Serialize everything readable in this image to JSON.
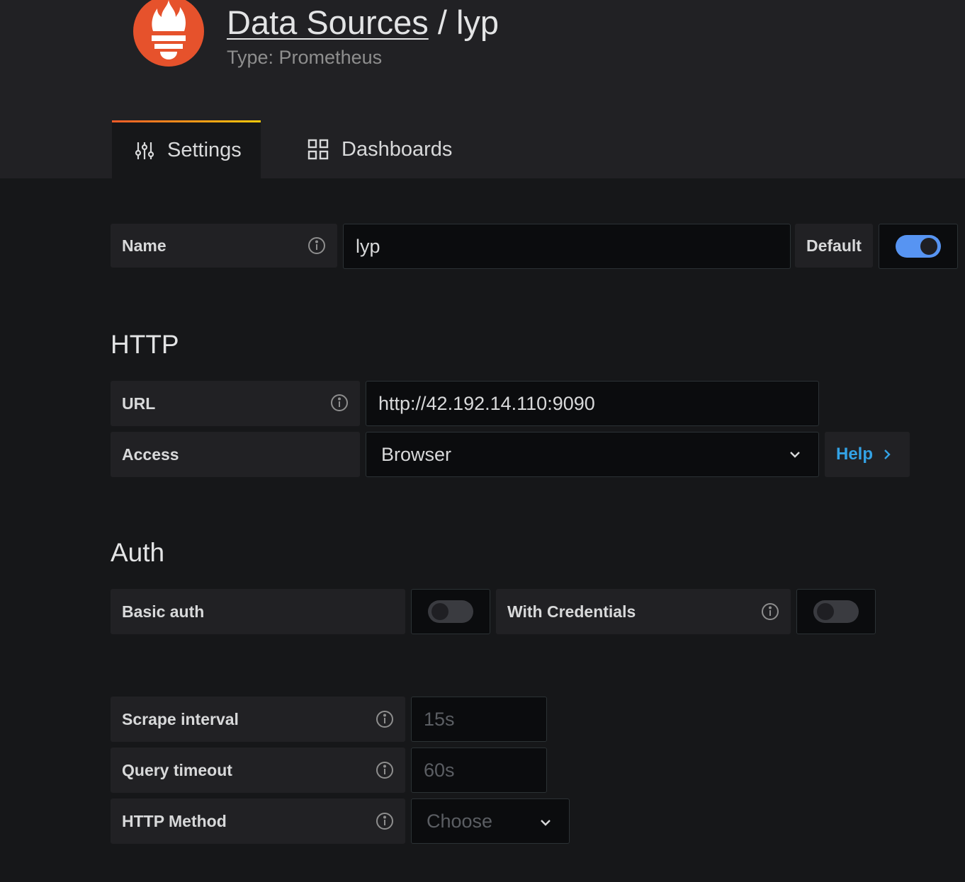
{
  "header": {
    "breadcrumb_link": "Data Sources",
    "separator": " / ",
    "datasource_name": "lyp",
    "subtitle": "Type: Prometheus",
    "logo_icon": "prometheus-logo-icon",
    "brand_color": "#e6522c"
  },
  "tabs": [
    {
      "label": "Settings",
      "icon": "sliders-icon",
      "active": true
    },
    {
      "label": "Dashboards",
      "icon": "grid-icon",
      "active": false
    }
  ],
  "name_row": {
    "label": "Name",
    "value": "lyp",
    "default_label": "Default",
    "default_on": true
  },
  "http": {
    "title": "HTTP",
    "url_label": "URL",
    "url_value": "http://42.192.14.110:9090",
    "access_label": "Access",
    "access_value": "Browser",
    "help_label": "Help"
  },
  "auth": {
    "title": "Auth",
    "basic_auth_label": "Basic auth",
    "basic_auth_on": false,
    "with_credentials_label": "With Credentials",
    "with_credentials_on": false
  },
  "prometheus": {
    "scrape_interval_label": "Scrape interval",
    "scrape_interval_placeholder": "15s",
    "query_timeout_label": "Query timeout",
    "query_timeout_placeholder": "60s",
    "http_method_label": "HTTP Method",
    "http_method_placeholder": "Choose"
  },
  "colors": {
    "accent_blue": "#5794f2",
    "link_blue": "#33a2e5",
    "tab_gradient_start": "#f05a28",
    "tab_gradient_end": "#fbca0a"
  }
}
